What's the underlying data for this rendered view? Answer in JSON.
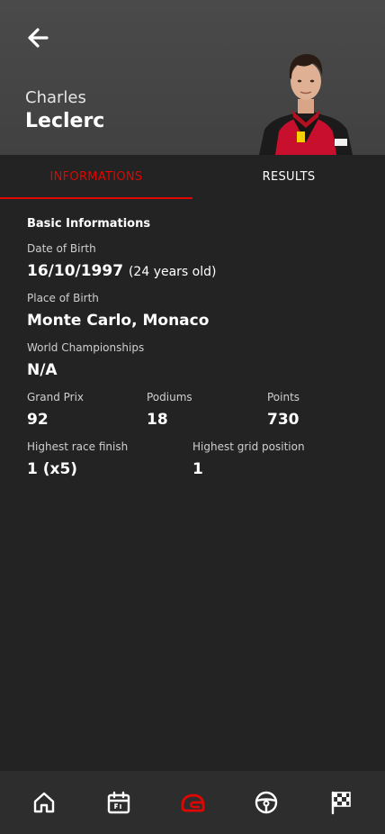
{
  "header": {
    "first_name": "Charles",
    "last_name": "Leclerc",
    "back_icon": "arrow-left-icon"
  },
  "tabs": [
    {
      "label": "INFORMATIONS",
      "active": true
    },
    {
      "label": "RESULTS",
      "active": false
    }
  ],
  "info": {
    "section_title": "Basic Informations",
    "dob_label": "Date of Birth",
    "dob_value": "16/10/1997",
    "dob_age": "(24 years old)",
    "pob_label": "Place of Birth",
    "pob_value": "Monte Carlo, Monaco",
    "wc_label": "World Championships",
    "wc_value": "N/A",
    "gp_label": "Grand Prix",
    "gp_value": "92",
    "podiums_label": "Podiums",
    "podiums_value": "18",
    "points_label": "Points",
    "points_value": "730",
    "hrf_label": "Highest race finish",
    "hrf_value": "1 (x5)",
    "hgp_label": "Highest grid position",
    "hgp_value": "1"
  },
  "nav": [
    {
      "icon": "home-icon",
      "active": false
    },
    {
      "icon": "calendar-f1-icon",
      "active": false
    },
    {
      "icon": "helmet-icon",
      "active": true
    },
    {
      "icon": "steering-wheel-icon",
      "active": false
    },
    {
      "icon": "checkered-flag-icon",
      "active": false
    }
  ],
  "colors": {
    "accent": "#e10600",
    "background": "#232323",
    "header_bg": "#454545",
    "nav_bg": "#2d2d2d"
  }
}
